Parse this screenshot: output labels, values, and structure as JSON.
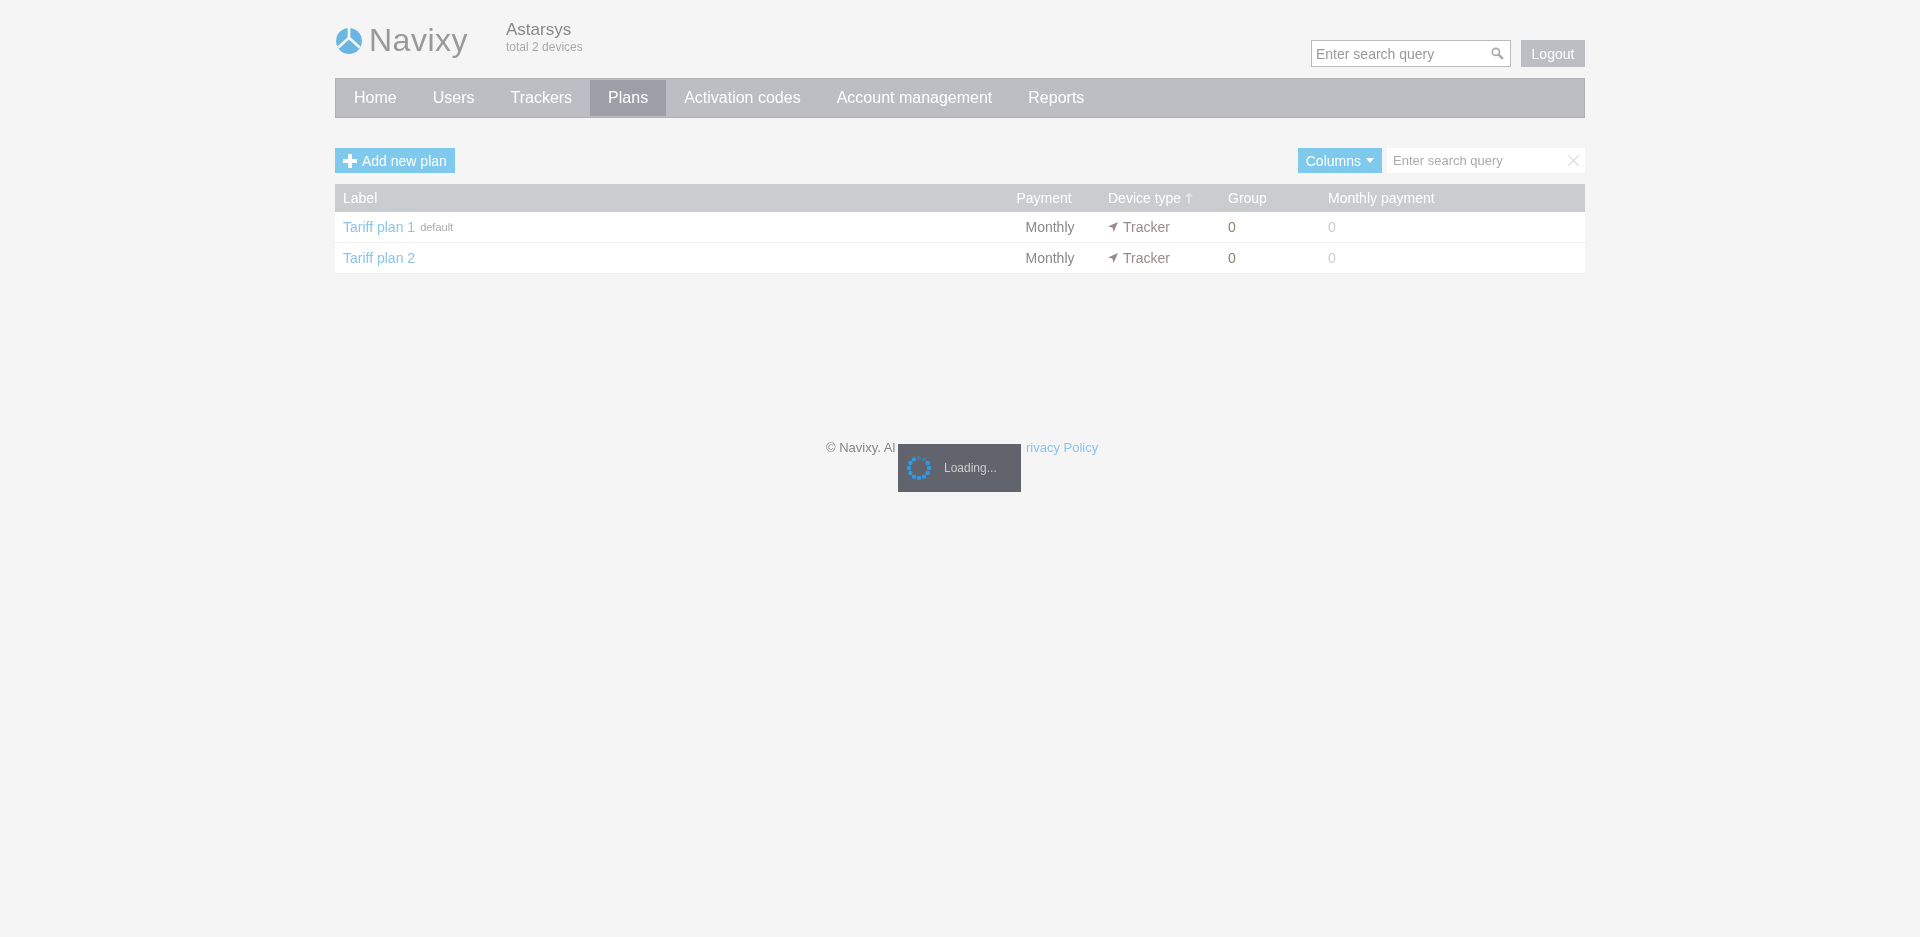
{
  "header": {
    "logo_text": "Navixy",
    "account_name": "Astarsys",
    "account_subtitle": "total 2 devices",
    "search": {
      "placeholder": "Enter search query"
    },
    "logout_button": "Logout"
  },
  "nav": [
    {
      "label": "Home",
      "selected": false
    },
    {
      "label": "Users",
      "selected": false
    },
    {
      "label": "Trackers",
      "selected": false
    },
    {
      "label": "Plans",
      "selected": true
    },
    {
      "label": "Activation codes",
      "selected": false
    },
    {
      "label": "Account management",
      "selected": false
    },
    {
      "label": "Reports",
      "selected": false
    }
  ],
  "toolbar": {
    "add_button": "Add new plan",
    "columns_button": "Columns",
    "search": {
      "placeholder": "Enter search query"
    }
  },
  "table": {
    "columns": [
      {
        "label": "Label",
        "sorted": false
      },
      {
        "label": "Payment",
        "sorted": false
      },
      {
        "label": "Device type",
        "sorted": true
      },
      {
        "label": "Group",
        "sorted": false
      },
      {
        "label": "Monthly payment",
        "sorted": false
      }
    ],
    "rows": [
      {
        "label": "Tariff plan 1",
        "tag": "default",
        "payment": "Monthly",
        "device_type": "Tracker",
        "group": "0",
        "monthly_payment": "0"
      },
      {
        "label": "Tariff plan 2",
        "payment": "Monthly",
        "device_type": "Tracker",
        "group": "0",
        "monthly_payment": "0"
      }
    ]
  },
  "footer": {
    "text": "© Navixy. Al",
    "privacy_link": "rivacy Policy"
  },
  "loading": {
    "text": "Loading..."
  }
}
